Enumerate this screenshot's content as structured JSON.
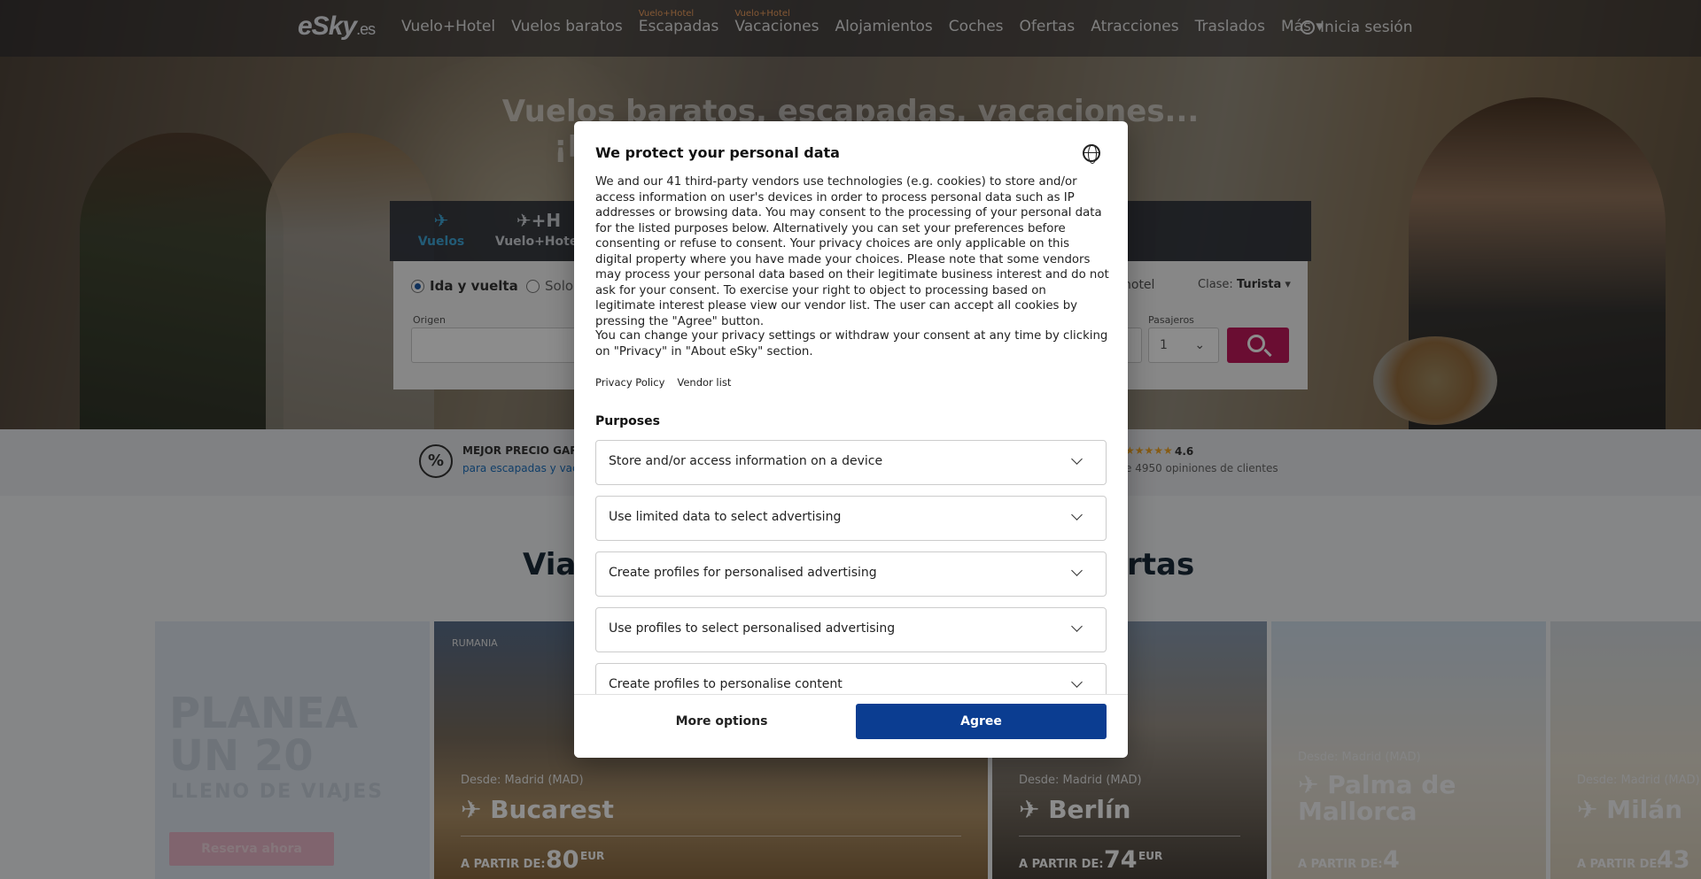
{
  "nav": {
    "logo_main": "eSky",
    "logo_suffix": ".es",
    "items": [
      {
        "label": "Vuelo+Hotel",
        "tag": ""
      },
      {
        "label": "Vuelos baratos",
        "tag": ""
      },
      {
        "label": "Escapadas",
        "tag": "Vuelo+Hotel"
      },
      {
        "label": "Vacaciones",
        "tag": "Vuelo+Hotel"
      },
      {
        "label": "Alojamientos",
        "tag": ""
      },
      {
        "label": "Coches",
        "tag": ""
      },
      {
        "label": "Ofertas",
        "tag": ""
      },
      {
        "label": "Atracciones",
        "tag": ""
      },
      {
        "label": "Traslados",
        "tag": ""
      },
      {
        "label": "Más ▾",
        "tag": ""
      }
    ],
    "signin": "Inicia sesión"
  },
  "hero": {
    "title_line1": "Vuelos baratos, escapadas, vacaciones...",
    "title_line2_left": "¡R",
    "title_line2_right": "a"
  },
  "search": {
    "tabs": [
      {
        "label": "Vuelos",
        "icon": "✈"
      },
      {
        "label": "Vuelo+Hotel",
        "icon": "✈+H"
      }
    ],
    "trip_round": "Ida y vuelta",
    "trip_oneway": "Solo",
    "hotel_opt": "hotel",
    "class_label": "Clase:",
    "class_value": "Turista",
    "origin_label": "Origen",
    "pax_label": "Pasajeros",
    "pax_value": "1"
  },
  "trust": {
    "best_price_title": "MEJOR PRECIO GARA",
    "best_price_sub": "para escapadas y vaca",
    "rating": "4.6",
    "reviews": "e 4950 opiniones de clientes"
  },
  "section": {
    "title_left": "Viaj",
    "title_right": "rtas"
  },
  "promo": {
    "line1": "PLANEA",
    "line2": "UN 20",
    "line3": "LLENO DE VIAJES",
    "button": "Reserva ahora"
  },
  "cards": [
    {
      "country": "RUMANIA",
      "from": "Desde: Madrid (MAD)",
      "city": "✈ Bucarest",
      "desde": "A PARTIR DE:",
      "price": "80",
      "currency": "EUR"
    },
    {
      "country": "",
      "from": "Desde: Madrid (MAD)",
      "city": "✈ Berlín",
      "desde": "A PARTIR DE:",
      "price": "74",
      "currency": "EUR"
    },
    {
      "country": "",
      "from": "Desde: Madrid (MAD)",
      "city": "✈ Palma de Mallorca",
      "desde": "A PARTIR DE:",
      "price": "4",
      "currency": ""
    },
    {
      "country": "",
      "from": "Desde: Madrid (MAD)",
      "city": "✈ Milán",
      "desde": "A PARTIR DE:",
      "price": "43",
      "currency": ""
    }
  ],
  "modal": {
    "title": "We protect your personal data",
    "description": "We and our 41 third-party vendors use technologies (e.g. cookies) to store and/or access information on user's devices in order to process personal data such as IP addresses or browsing data. You may consent to the processing of your personal data for the listed purposes below. Alternatively you can set your preferences before consenting or refuse to consent. Your privacy choices are only applicable on this digital property where you have made your choices. Please note that some vendors may process your personal data based on their legitimate business interest and do not ask for your consent. To exercise your right to object to processing based on legitimate interest please view our vendor list. The user can accept all cookies by pressing the \"Agree\" button.",
    "description2": "You can change your privacy settings or withdraw your consent at any time by clicking on \"Privacy\" in \"About eSky\" section.",
    "privacy_link": "Privacy Policy",
    "vendor_link": "Vendor list",
    "purposes_heading": "Purposes",
    "purposes": [
      "Store and/or access information on a device",
      "Use limited data to select advertising",
      "Create profiles for personalised advertising",
      "Use profiles to select personalised advertising",
      "Create profiles to personalise content"
    ],
    "more_options": "More options",
    "agree": "Agree"
  }
}
